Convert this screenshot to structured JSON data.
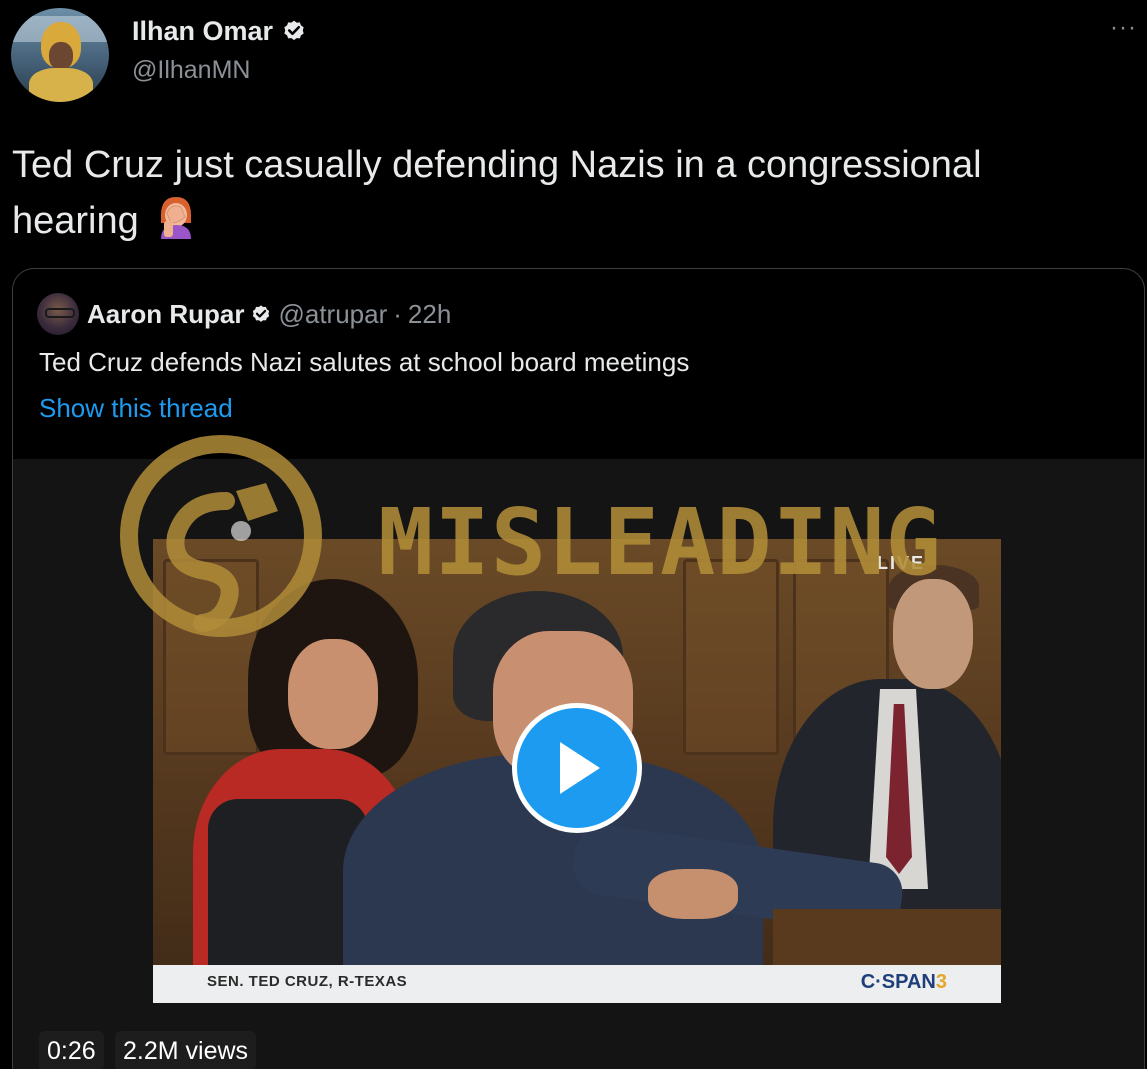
{
  "tweet": {
    "author_name": "Ilhan Omar",
    "author_handle": "@IlhanMN",
    "text": "Ted Cruz just casually defending Nazis in a congressional hearing",
    "emoji_icon": "facepalm-icon"
  },
  "quoted_tweet": {
    "author_name": "Aaron Rupar",
    "author_handle": "@atrupar",
    "separator": "·",
    "time": "22h",
    "text": "Ted Cruz defends Nazi salutes at school board meetings",
    "thread_link": "Show this thread"
  },
  "video": {
    "live_label": "LIVE",
    "chyron_name": "SEN. TED CRUZ, R-TEXAS",
    "channel_logo_main": "C·SPAN",
    "channel_logo_num": "3",
    "duration": "0:26",
    "views": "2.2M views"
  },
  "overlay": {
    "label": "MISLEADING",
    "color": "#b08c38"
  },
  "colors": {
    "background": "#000000",
    "link": "#1d9bf0",
    "verified": "#e7e9ea",
    "secondary_text": "#8b9197"
  }
}
